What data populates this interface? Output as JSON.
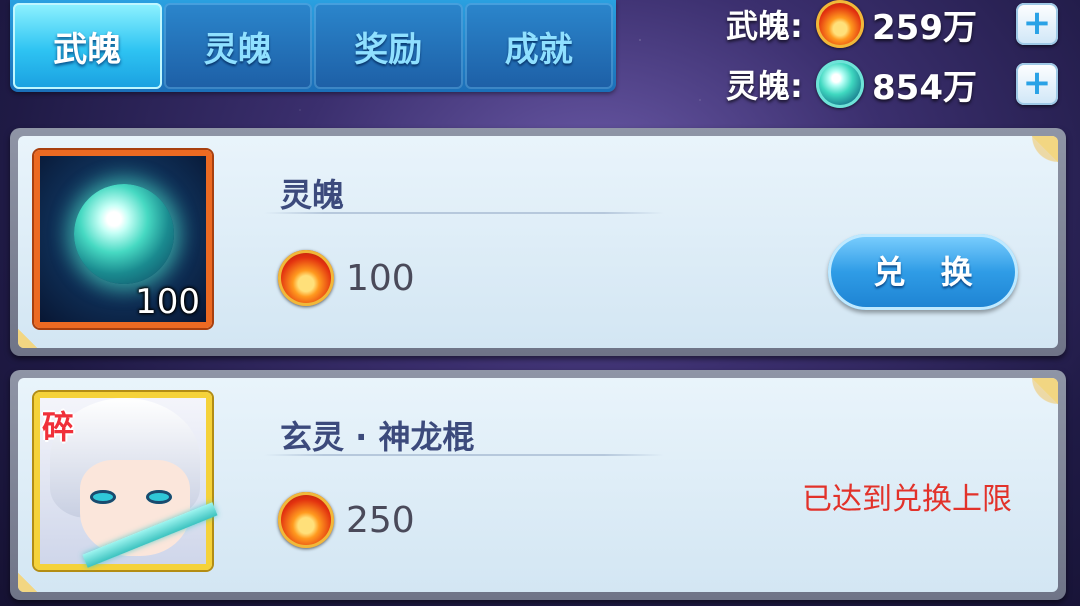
{
  "tabs": [
    {
      "label": "武魄",
      "active": true
    },
    {
      "label": "灵魄",
      "active": false
    },
    {
      "label": "奖励",
      "active": false
    },
    {
      "label": "成就",
      "active": false
    }
  ],
  "currency": [
    {
      "label": "武魄:",
      "icon": "fire-soul-icon",
      "value": "259万",
      "add": "+"
    },
    {
      "label": "灵魄:",
      "icon": "spirit-orb-icon",
      "value": "854万",
      "add": "+"
    }
  ],
  "items": [
    {
      "name": "灵魄",
      "icon": "spirit-orb-icon",
      "count": "100",
      "cost_icon": "fire-soul-icon",
      "cost": "100",
      "action": "兑 换"
    },
    {
      "name": "玄灵 · 神龙棍",
      "icon": "hero-portrait",
      "badge": "碎",
      "cost_icon": "fire-soul-icon",
      "cost": "250",
      "status": "已达到兑换上限"
    }
  ],
  "colors": {
    "tab_active": "#2ec3f2",
    "tab_inactive": "#1d5fa6",
    "limit_text": "#e2322a",
    "frame_orange": "#ec6a22",
    "frame_gold": "#f5d23a"
  }
}
